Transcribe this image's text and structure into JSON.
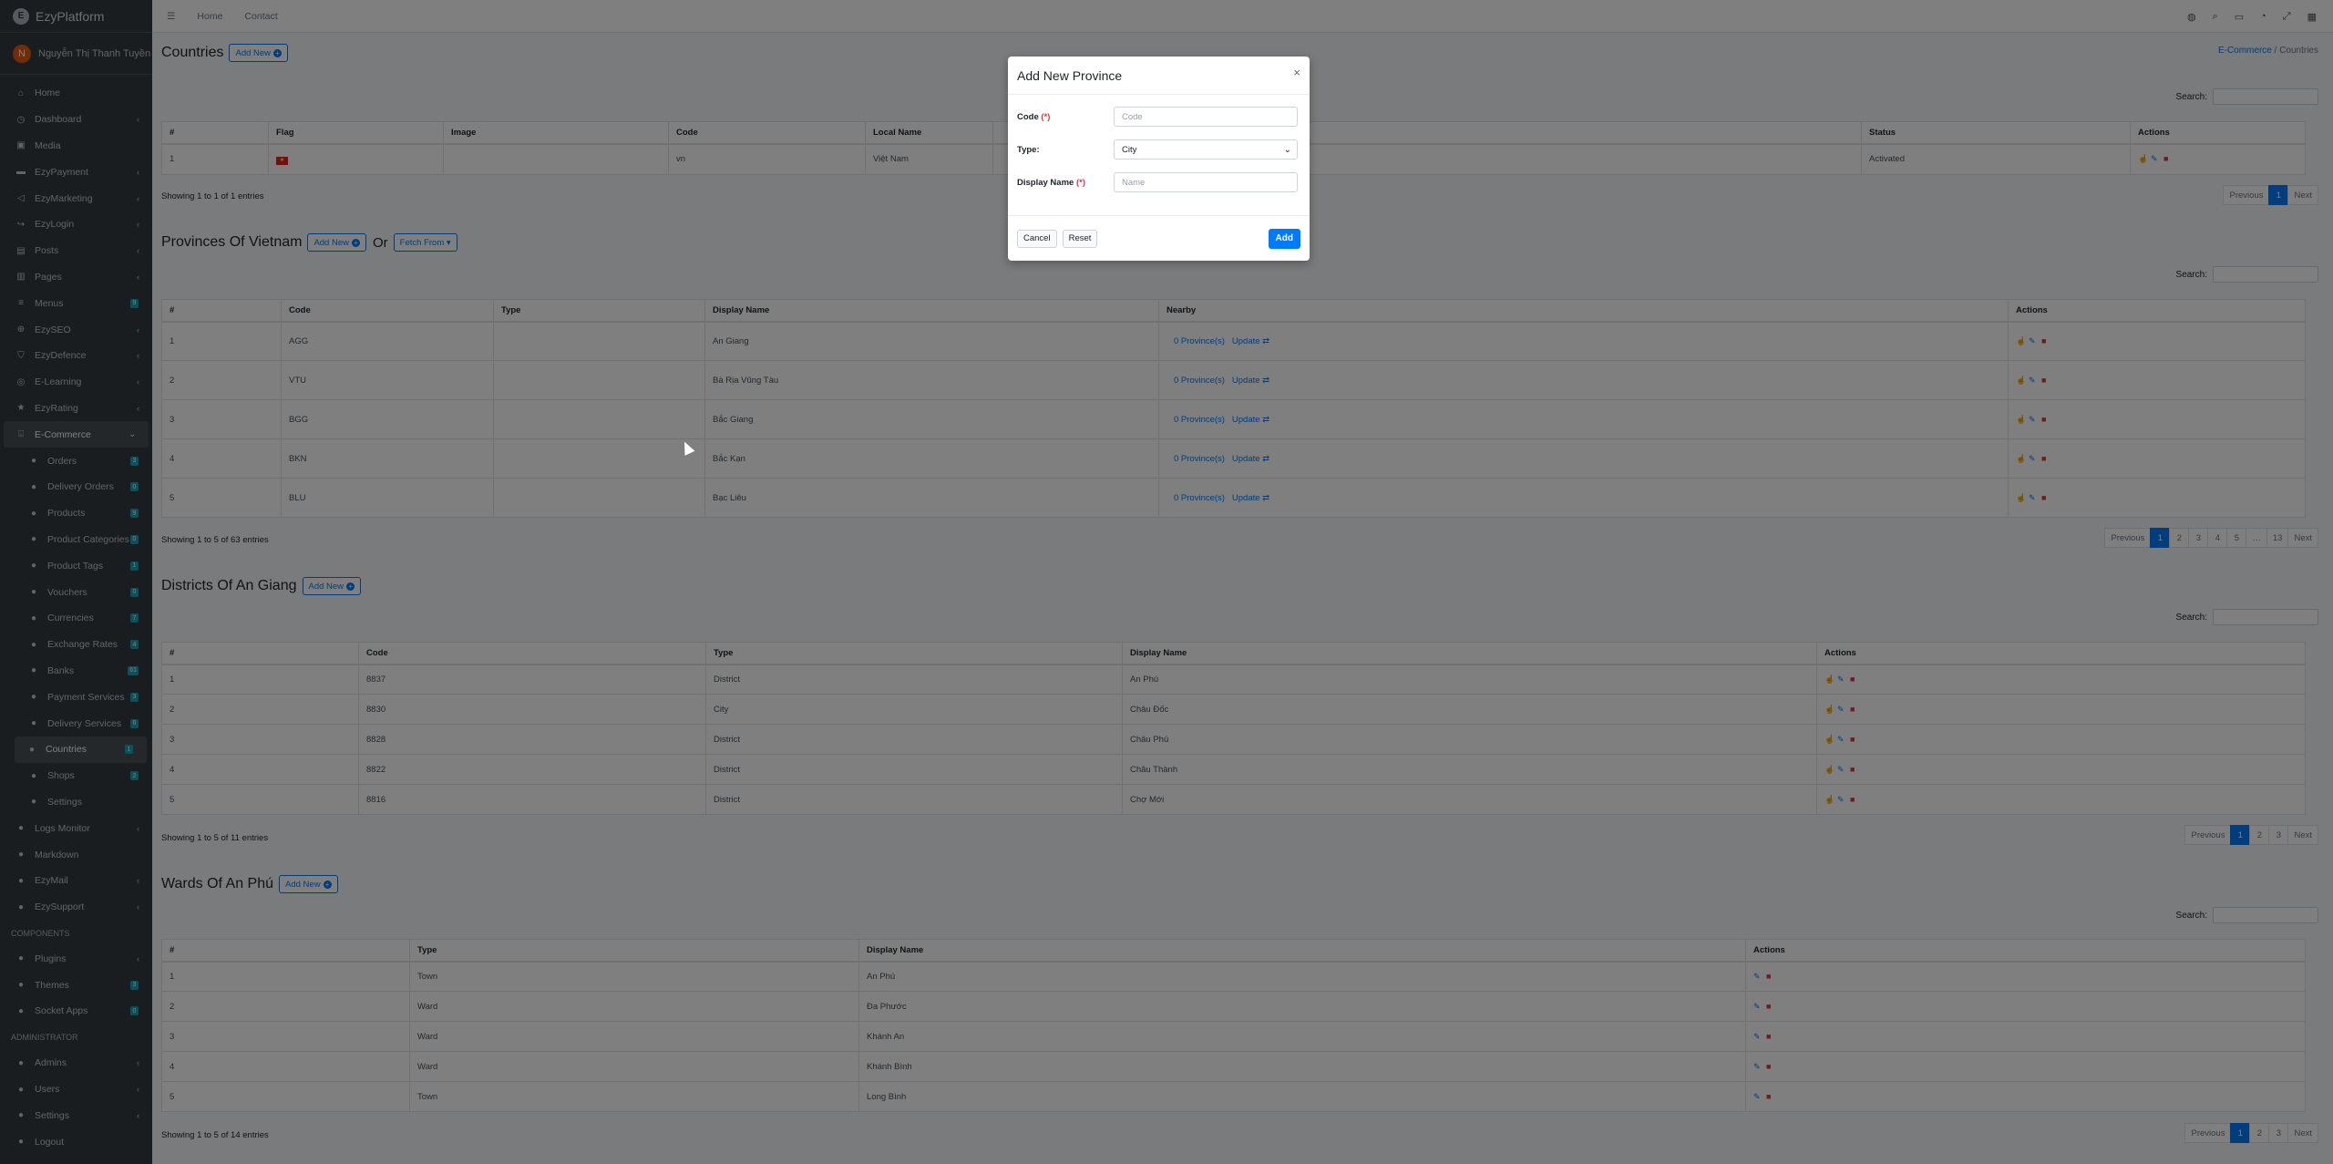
{
  "brand": {
    "name": "EzyPlatform",
    "logo_letter": "E"
  },
  "user": {
    "initial": "N",
    "name": "Nguyễn Thị Thanh Tuyền"
  },
  "sidebar": {
    "items": [
      {
        "label": "Home",
        "icon": "home-icon"
      },
      {
        "label": "Dashboard",
        "icon": "dashboard-icon",
        "chevron": "‹"
      },
      {
        "label": "Media",
        "icon": "image-icon"
      },
      {
        "label": "EzyPayment",
        "icon": "payment-icon",
        "chevron": "‹"
      },
      {
        "label": "EzyMarketing",
        "icon": "megaphone-icon",
        "chevron": "‹"
      },
      {
        "label": "EzyLogin",
        "icon": "login-icon",
        "chevron": "‹"
      },
      {
        "label": "Posts",
        "icon": "posts-icon",
        "chevron": "‹"
      },
      {
        "label": "Pages",
        "icon": "pages-icon",
        "chevron": "‹"
      },
      {
        "label": "Menus",
        "icon": "menu-icon",
        "badge": "9"
      },
      {
        "label": "EzySEO",
        "icon": "seo-icon",
        "chevron": "‹"
      },
      {
        "label": "EzyDefence",
        "icon": "shield-icon",
        "chevron": "‹"
      },
      {
        "label": "E-Learning",
        "icon": "learning-icon",
        "chevron": "‹"
      },
      {
        "label": "EzyRating",
        "icon": "star-icon",
        "chevron": "‹"
      },
      {
        "label": "E-Commerce",
        "icon": "cart-icon",
        "chevron": "⌄"
      }
    ],
    "ecommerce_items": [
      {
        "label": "Orders",
        "badge": "3"
      },
      {
        "label": "Delivery Orders",
        "badge": "0"
      },
      {
        "label": "Products",
        "badge": "9"
      },
      {
        "label": "Product Categories",
        "badge": "0"
      },
      {
        "label": "Product Tags",
        "badge": "1"
      },
      {
        "label": "Vouchers",
        "badge": "0"
      },
      {
        "label": "Currencies",
        "badge": "7"
      },
      {
        "label": "Exchange Rates",
        "badge": "4"
      },
      {
        "label": "Banks",
        "badge": "61"
      },
      {
        "label": "Payment Services",
        "badge": "3"
      },
      {
        "label": "Delivery Services",
        "badge": "6"
      },
      {
        "label": "Countries",
        "badge": "1"
      },
      {
        "label": "Shops",
        "badge": "2"
      },
      {
        "label": "Settings"
      }
    ],
    "after_items": [
      {
        "label": "Logs Monitor",
        "chevron": "‹"
      },
      {
        "label": "Markdown"
      },
      {
        "label": "EzyMail",
        "chevron": "‹"
      },
      {
        "label": "EzySupport",
        "chevron": "‹"
      }
    ],
    "components_header": "COMPONENTS",
    "components_items": [
      {
        "label": "Plugins",
        "chevron": "‹"
      },
      {
        "label": "Themes",
        "badge": "3"
      },
      {
        "label": "Socket Apps",
        "badge": "0"
      }
    ],
    "admin_header": "ADMINISTRATOR",
    "admin_items": [
      {
        "label": "Admins",
        "chevron": "‹"
      },
      {
        "label": "Users",
        "chevron": "‹"
      },
      {
        "label": "Settings",
        "chevron": "‹"
      },
      {
        "label": "Logout"
      }
    ]
  },
  "topbar": {
    "links": [
      "Home",
      "Contact"
    ]
  },
  "breadcrumb": {
    "parent": "E-Commerce",
    "separator": "/",
    "current": "Countries"
  },
  "common": {
    "search_label": "Search:",
    "add_new": "Add New",
    "previous": "Previous",
    "next": "Next",
    "ellipsis": "…"
  },
  "countries": {
    "title": "Countries",
    "headers": [
      "#",
      "Flag",
      "Image",
      "Code",
      "Local Name",
      "",
      "Status",
      "Actions"
    ],
    "rows": [
      {
        "no": "1",
        "flag": "★",
        "image": "",
        "code": "vn",
        "local_name": "Việt Nam",
        "status": "Activated"
      }
    ],
    "info": "Showing 1 to 1 of 1 entries",
    "pages": [
      "1"
    ]
  },
  "provinces": {
    "title": "Provinces Of Vietnam",
    "or": "Or",
    "fetch_from": "Fetch From",
    "headers": [
      "#",
      "Code",
      "Type",
      "Display Name",
      "Nearby",
      "Actions"
    ],
    "rows": [
      {
        "no": "1",
        "code": "AGG",
        "type": "",
        "name": "An Giang",
        "nearby": "0 Province(s)",
        "update": "Update"
      },
      {
        "no": "2",
        "code": "VTU",
        "type": "",
        "name": "Bà Rịa Vũng Tàu",
        "nearby": "0 Province(s)",
        "update": "Update"
      },
      {
        "no": "3",
        "code": "BGG",
        "type": "",
        "name": "Bắc Giang",
        "nearby": "0 Province(s)",
        "update": "Update"
      },
      {
        "no": "4",
        "code": "BKN",
        "type": "",
        "name": "Bắc Kạn",
        "nearby": "0 Province(s)",
        "update": "Update"
      },
      {
        "no": "5",
        "code": "BLU",
        "type": "",
        "name": "Bạc Liêu",
        "nearby": "0 Province(s)",
        "update": "Update"
      }
    ],
    "info": "Showing 1 to 5 of 63 entries",
    "pages": [
      "1",
      "2",
      "3",
      "4",
      "5",
      "…",
      "13"
    ]
  },
  "districts": {
    "title": "Districts Of An Giang",
    "headers": [
      "#",
      "Code",
      "Type",
      "Display Name",
      "Actions"
    ],
    "rows": [
      {
        "no": "1",
        "code": "8837",
        "type": "District",
        "name": "An Phú"
      },
      {
        "no": "2",
        "code": "8830",
        "type": "City",
        "name": "Châu Đốc"
      },
      {
        "no": "3",
        "code": "8828",
        "type": "District",
        "name": "Châu Phú"
      },
      {
        "no": "4",
        "code": "8822",
        "type": "District",
        "name": "Châu Thành"
      },
      {
        "no": "5",
        "code": "8816",
        "type": "District",
        "name": "Chợ Mới"
      }
    ],
    "info": "Showing 1 to 5 of 11 entries",
    "pages": [
      "1",
      "2",
      "3"
    ]
  },
  "wards": {
    "title": "Wards Of An Phú",
    "headers": [
      "#",
      "Type",
      "Display Name",
      "Actions"
    ],
    "rows": [
      {
        "no": "1",
        "type": "Town",
        "name": "An Phú"
      },
      {
        "no": "2",
        "type": "Ward",
        "name": "Đa Phước"
      },
      {
        "no": "3",
        "type": "Ward",
        "name": "Khánh An"
      },
      {
        "no": "4",
        "type": "Ward",
        "name": "Khánh Bình"
      },
      {
        "no": "5",
        "type": "Town",
        "name": "Long Bình"
      }
    ],
    "info": "Showing 1 to 5 of 14 entries",
    "pages": [
      "1",
      "2",
      "3"
    ]
  },
  "modal": {
    "title": "Add New Province",
    "close": "×",
    "code_label": "Code",
    "code_placeholder": "Code",
    "type_label": "Type:",
    "type_value": "City",
    "name_label": "Display Name",
    "name_placeholder": "Name",
    "required_mark": "(*)",
    "cancel": "Cancel",
    "reset": "Reset",
    "add": "Add"
  },
  "colors": {
    "primary": "#007bff",
    "danger": "#dc3545",
    "success": "#28a745",
    "sidebar": "#343a40"
  }
}
